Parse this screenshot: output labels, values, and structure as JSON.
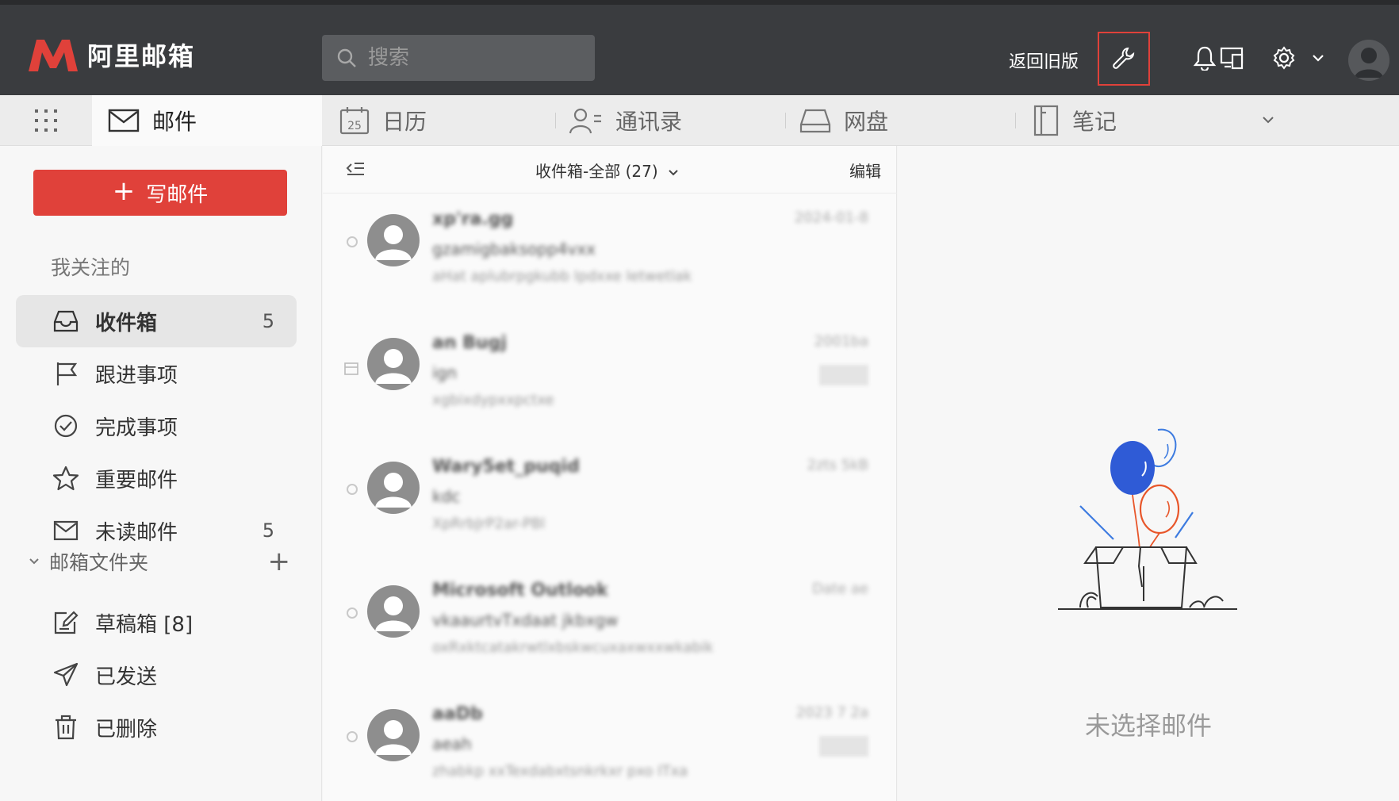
{
  "header": {
    "logo_text": "阿里邮箱",
    "search_placeholder": "搜索",
    "back_to_old": "返回旧版",
    "icons": [
      "wrench-icon",
      "bell-icon",
      "devices-icon",
      "gear-icon",
      "chevron-down-icon",
      "avatar"
    ],
    "accent_color": "#e0413a"
  },
  "apps": [
    {
      "label": "邮件",
      "icon": "mail-icon",
      "active": true
    },
    {
      "label": "日历",
      "icon": "calendar-icon",
      "calendar_day": "25"
    },
    {
      "label": "通讯录",
      "icon": "contacts-icon"
    },
    {
      "label": "网盘",
      "icon": "drive-icon"
    },
    {
      "label": "笔记",
      "icon": "notes-icon"
    }
  ],
  "sidebar": {
    "compose_label": "写邮件",
    "favorites_label": "我关注的",
    "favorites": [
      {
        "label": "收件箱",
        "count": "5",
        "icon": "inbox-icon",
        "active": true
      },
      {
        "label": "跟进事项",
        "count": "",
        "icon": "flag-icon"
      },
      {
        "label": "完成事项",
        "count": "",
        "icon": "check-circle-icon"
      },
      {
        "label": "重要邮件",
        "count": "",
        "icon": "star-icon"
      },
      {
        "label": "未读邮件",
        "count": "5",
        "icon": "envelope-icon"
      }
    ],
    "folders_label": "邮箱文件夹",
    "folders": [
      {
        "label": "草稿箱 [8]",
        "icon": "draft-icon"
      },
      {
        "label": "已发送",
        "icon": "send-icon"
      },
      {
        "label": "已删除",
        "icon": "trash-icon"
      }
    ]
  },
  "mail_list": {
    "title": "收件箱-全部 (27)",
    "edit_label": "编辑",
    "emails": [
      {
        "sender": "xp'ra.gg",
        "subject": "gzamigbaksopp4vxx",
        "preview": "aHat aplubrpgkubb Ipdxxe Ietwetlak",
        "date": "2024-01-8",
        "tag": false
      },
      {
        "sender": "an Bugj",
        "subject": "ign",
        "preview": "xgbixdypxxpctxe",
        "date": "2001ba",
        "tag": true
      },
      {
        "sender": "Wary5et_puqid",
        "subject": "kdc",
        "preview": "XpRrbJrP2ar-PBl",
        "date": "2zts 5kB",
        "tag": false
      },
      {
        "sender": "Microsoft Outlook",
        "subject": "vkaaurtvTxdaat jkbxgw",
        "preview": "oxRxktcatakrwtlxbskwcuxaxwxxwkabik",
        "date": "Date ae",
        "tag": false
      },
      {
        "sender": "aaDb",
        "subject": "aeah",
        "preview": "zhabkp xxTexdabxtsnkrkxr pxo ITxa",
        "date": "2023 7 2a",
        "tag": true
      }
    ]
  },
  "reading_pane": {
    "empty_text": "未选择邮件",
    "balloon_colors": [
      "#2f5bd6",
      "#e8562a",
      "#3d7be0"
    ]
  }
}
